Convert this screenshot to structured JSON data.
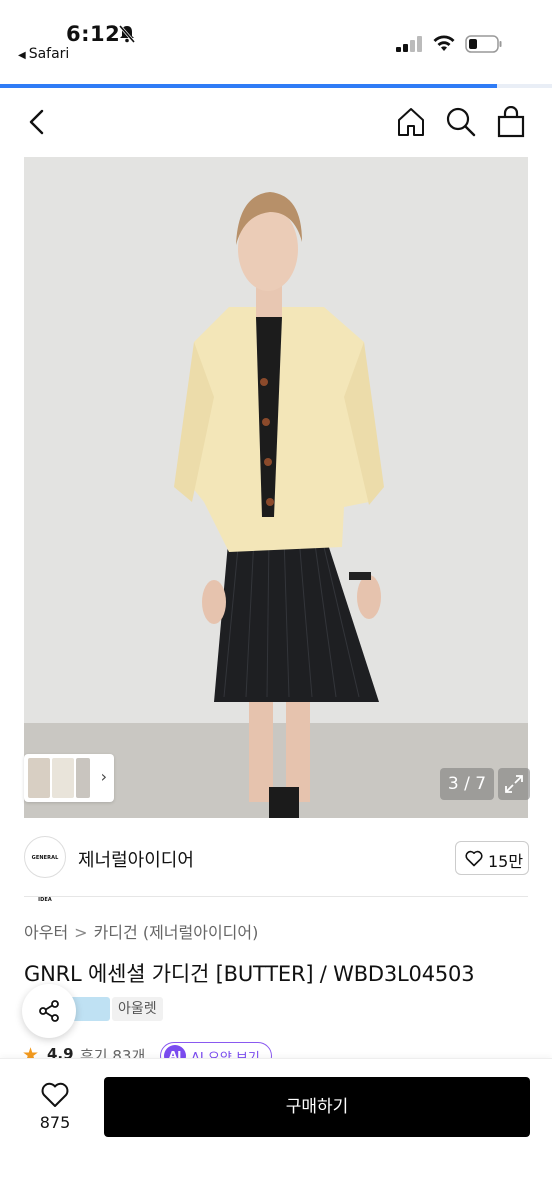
{
  "status_bar": {
    "time": "6:12",
    "back_app": "Safari",
    "page_load_progress": 0.9
  },
  "nav": {
    "back_icon": "chevron-left-icon",
    "home_icon": "home-icon",
    "search_icon": "search-icon",
    "cart_icon": "shopping-bag-icon"
  },
  "gallery": {
    "counter": "3 / 7",
    "current_image": 3,
    "total_images": 7
  },
  "brand": {
    "logo_text": "GENERAL IDEA",
    "name": "제너럴아이디어",
    "likes": "15만"
  },
  "product": {
    "breadcrumb": [
      "아우터",
      "카디건 (제너럴아이디어)"
    ],
    "title": "GNRL 에센셜 가디건 [BUTTER] / WBD3L04503",
    "tag_outlet": "아울렛",
    "rating": "4.9",
    "reviews": "후기 83개",
    "ai_badge": "AI",
    "ai_summary_label": "AI 요약 보기"
  },
  "bottom_bar": {
    "wish_count": "875",
    "buy_label": "구매하기"
  },
  "colors": {
    "accent_blue": "#2f7cf6",
    "buy_button": "#000000",
    "star": "#f29a1f",
    "ai_purple": "#7b4cf0"
  }
}
